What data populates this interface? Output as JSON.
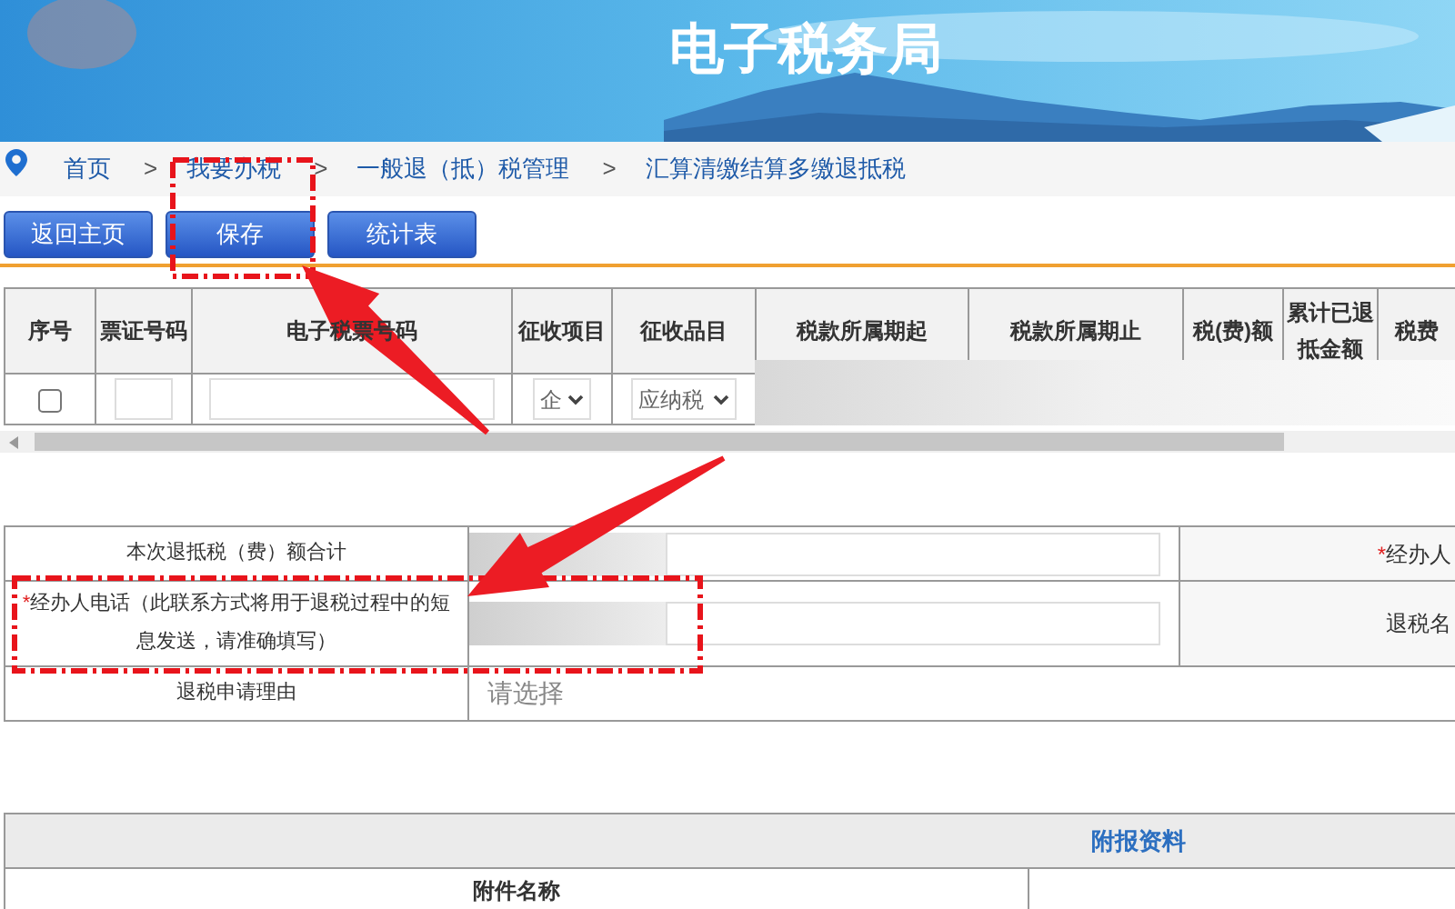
{
  "banner": {
    "title": "电子税务局"
  },
  "breadcrumb": [
    {
      "kind": "link",
      "label": "首页"
    },
    {
      "kind": "separator",
      "label": ">"
    },
    {
      "kind": "link",
      "label": "我要办税"
    },
    {
      "kind": "separator",
      "label": ">"
    },
    {
      "kind": "link",
      "label": "一般退（抵）税管理"
    },
    {
      "kind": "separator",
      "label": ">"
    },
    {
      "kind": "link",
      "label": "汇算清缴结算多缴退抵税"
    }
  ],
  "buttons": [
    "返回主页",
    "保存",
    "统计表"
  ],
  "grid": {
    "columns": [
      "序号",
      "票证号码",
      "电子税票号码",
      "征收项目",
      "征收品目",
      "税款所属期起",
      "税款所属期止",
      "税(费)额",
      "累计已退抵金额",
      "税费"
    ],
    "row": {
      "checked": false,
      "collection_item": "企",
      "collection_category": "应纳税"
    }
  },
  "form": {
    "rows": [
      {
        "label": {
          "text": "本次退抵税（费）额合计"
        },
        "kind": "input",
        "side_label": {
          "mark": "*",
          "text": "经办人"
        }
      },
      {
        "label": {
          "mark": "*",
          "text": "经办人电话（此联系方式将用于退税过程中的短息发送，请准确填写）"
        },
        "kind": "input",
        "side_label": {
          "text": "退税名"
        }
      },
      {
        "label": {
          "text": "退税申请理由"
        },
        "kind": "select",
        "placeholder": "请选择"
      }
    ]
  },
  "attachments": {
    "title": "附报资料",
    "columns": [
      "附件名称"
    ]
  },
  "annotations": [
    {
      "kind": "box"
    },
    {
      "kind": "box"
    },
    {
      "kind": "arrow"
    },
    {
      "kind": "arrow"
    }
  ]
}
